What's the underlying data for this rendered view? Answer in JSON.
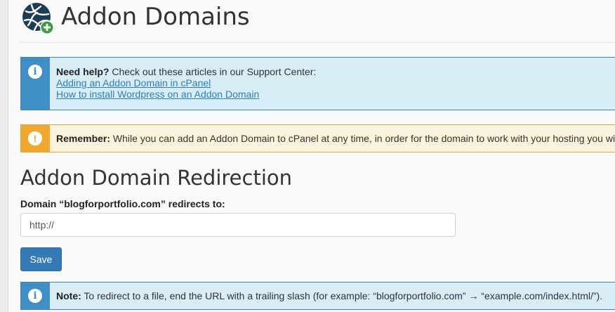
{
  "header": {
    "title": "Addon Domains",
    "icon": "globe-plus-icon"
  },
  "help_alert": {
    "icon": "info-icon",
    "icon_glyph": "i",
    "lead": "Need help?",
    "text": " Check out these articles in our Support Center:",
    "links": [
      "Adding an Addon Domain in cPanel",
      "How to install Wordpress on an Addon Domain"
    ]
  },
  "remember_alert": {
    "icon": "exclamation-icon",
    "icon_glyph": "!",
    "lead": "Remember:",
    "text": " While you can add an Addon Domain to cPanel at any time, in order for the domain to work with your hosting you wi"
  },
  "redirection": {
    "title": "Addon Domain Redirection",
    "label": "Domain “blogforportfolio.com” redirects to:",
    "input_value": "http://",
    "save_label": "Save"
  },
  "note_alert": {
    "icon": "info-icon",
    "icon_glyph": "i",
    "lead": "Note:",
    "text": " To redirect to a file, end the URL with a trailing slash (for example: “blogforportfolio.com” → “example.com/index.html/”)."
  },
  "colors": {
    "info": "#3f8fc6",
    "warning": "#f0a830",
    "button": "#337ab7",
    "link": "#2a7fbf"
  }
}
